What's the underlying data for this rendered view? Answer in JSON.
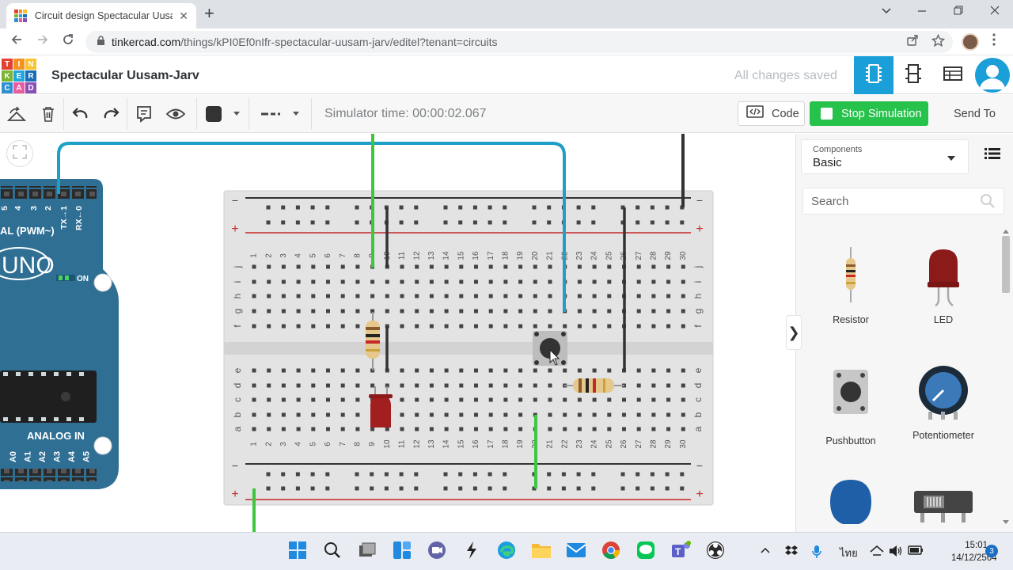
{
  "browser": {
    "tab_title": "Circuit design Spectacular Uusam-Jarv | Tinkercad",
    "tab_close": "✕",
    "new_tab": "+",
    "url_domain": "tinkercad.com",
    "url_path": "/things/kPI0Ef0nIfr-spectacular-uusam-jarv/editel?tenant=circuits"
  },
  "app": {
    "logo_letters": [
      "TIN",
      "KER",
      "CAD"
    ],
    "logo_colors": [
      "#e2412f",
      "#f39221",
      "#fbc22f",
      "#7ab532",
      "#22a5dc",
      "#1a6cb6",
      "#2f8fd3",
      "#e85b9f",
      "#8a4fb5"
    ],
    "project_name": "Spectacular Uusam-Jarv",
    "save_status": "All changes saved"
  },
  "toolbar": {
    "sim_time": "Simulator time: 00:00:02.067",
    "code_label": "Code",
    "stop_label": "Stop Simulation",
    "send_to_label": "Send To"
  },
  "panel": {
    "dropdown_caption": "Components",
    "dropdown_value": "Basic",
    "search_placeholder": "Search",
    "components": [
      {
        "name": "Resistor",
        "icon": "resistor-icon"
      },
      {
        "name": "LED",
        "icon": "led-icon"
      },
      {
        "name": "Pushbutton",
        "icon": "pushbutton-icon"
      },
      {
        "name": "Potentiometer",
        "icon": "potentiometer-icon"
      },
      {
        "name": "",
        "icon": "capacitor-icon"
      },
      {
        "name": "",
        "icon": "slideswitch-icon"
      }
    ]
  },
  "arduino": {
    "pin_labels_top": [
      "5",
      "4",
      "3",
      "2",
      "TX→1",
      "RX←0"
    ],
    "digital_label": "AL (PWM~)",
    "model_label": "UNO",
    "on_label": "ON",
    "analog_label": "ANALOG IN",
    "analog_pins": [
      "A0",
      "A1",
      "A2",
      "A3",
      "A4",
      "A5"
    ]
  },
  "breadboard": {
    "rail_minus": "−",
    "rail_plus": "+",
    "row_letters_top": [
      "j",
      "i",
      "h",
      "g",
      "f"
    ],
    "row_letters_bottom": [
      "e",
      "d",
      "c",
      "b",
      "a"
    ],
    "columns": 30
  },
  "taskbar": {
    "language": "ไทย",
    "time": "15:01",
    "date": "14/12/2564",
    "notification_count": "3"
  }
}
